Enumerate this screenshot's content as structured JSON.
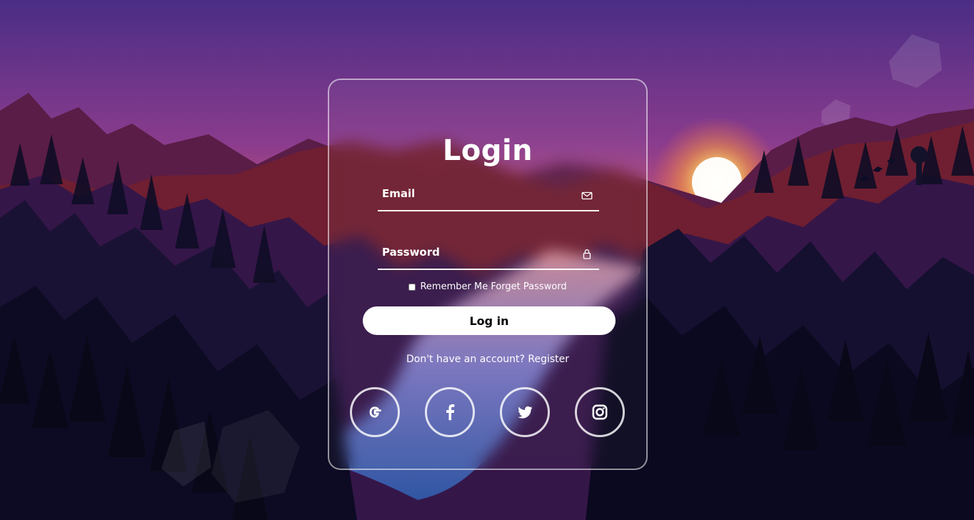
{
  "login": {
    "title": "Login",
    "email_placeholder": "Email",
    "password_placeholder": "Password",
    "remember_label": "Remember Me",
    "forget_password": "Forget Password",
    "submit_label": "Log in",
    "register_prompt": "Don't have an account?",
    "register_link": "Register"
  },
  "icons": {
    "email": "mail-icon",
    "password": "lock-icon",
    "google": "google-icon",
    "facebook": "facebook-icon",
    "twitter": "twitter-icon",
    "instagram": "instagram-icon"
  },
  "colors": {
    "card_border": "#ffffff",
    "button_background": "#ffffff",
    "button_text": "#000000",
    "text": "#ffffff"
  }
}
